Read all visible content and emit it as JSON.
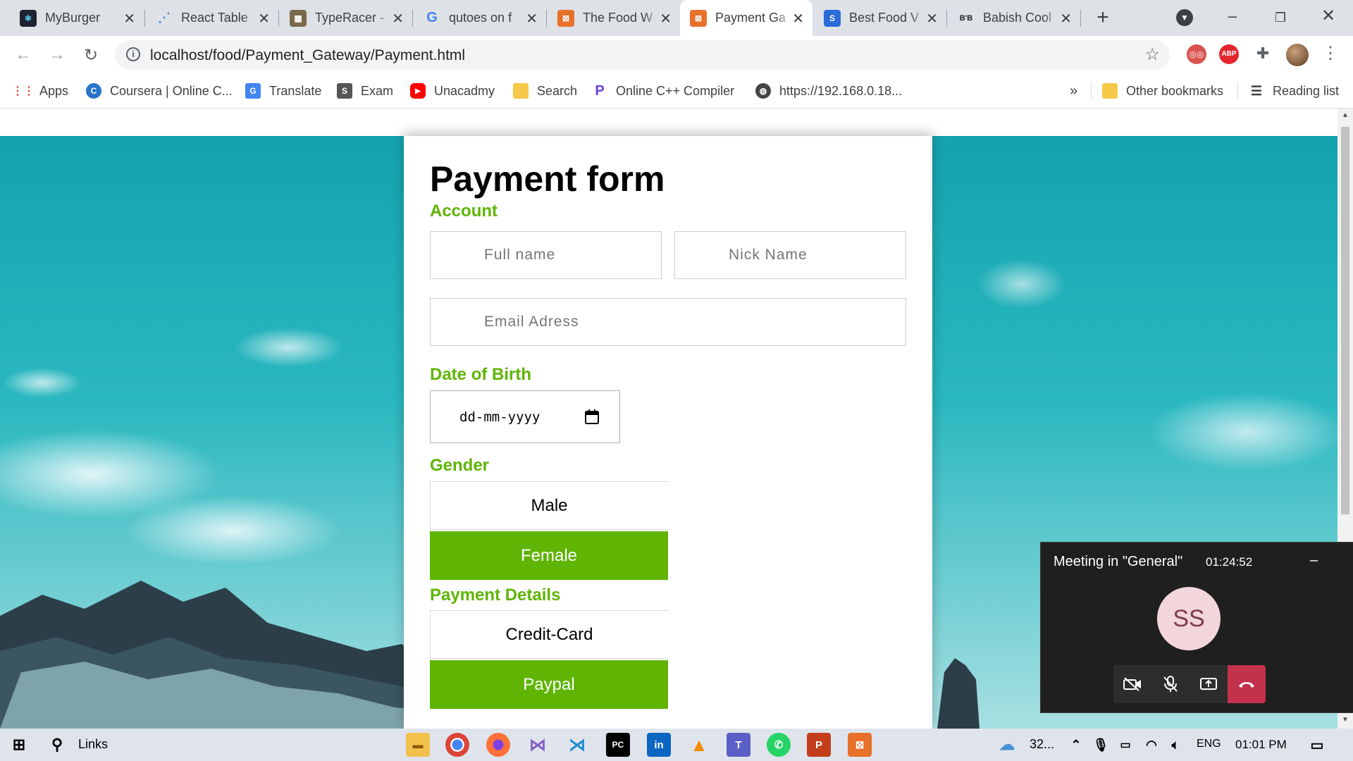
{
  "tabs": [
    {
      "title": "MyBurger",
      "favicon_text": "⚛",
      "color": "#1c2433"
    },
    {
      "title": "React Table",
      "favicon_text": "⋰",
      "color": "#4b8bde"
    },
    {
      "title": "TypeRacer -",
      "favicon_text": "▦",
      "color": "#7a6a4b"
    },
    {
      "title": "qutoes on f",
      "favicon_text": "G",
      "color": "#ffffff"
    },
    {
      "title": "The Food W",
      "favicon_text": "⊠",
      "color": "#e8702a"
    },
    {
      "title": "Payment Ga",
      "favicon_text": "⊠",
      "color": "#e8702a"
    },
    {
      "title": "Best Food V",
      "favicon_text": "S",
      "color": "#2a6bd8"
    },
    {
      "title": "Babish Cool",
      "favicon_text": "B'B",
      "color": "#222222"
    }
  ],
  "toolbar": {
    "url": "localhost/food/Payment_Gateway/Payment.html",
    "info_icon": "info-icon"
  },
  "bookmarks": [
    {
      "label": "Apps",
      "icon_text": "⋮⋮",
      "color": "#4285f4"
    },
    {
      "label": "Coursera | Online C...",
      "icon_text": "C",
      "color": "#2a73cc"
    },
    {
      "label": "Translate",
      "icon_text": "G",
      "color": "#4285f4"
    },
    {
      "label": "Exam",
      "icon_text": "S",
      "color": "#555555"
    },
    {
      "label": "Unacadmy",
      "icon_text": "▶",
      "color": "#ff0000"
    },
    {
      "label": "Search",
      "icon_text": "",
      "color": "#f7c948"
    },
    {
      "label": "Online C++ Compiler",
      "icon_text": "P",
      "color": "#6c3fe0"
    },
    {
      "label": "https://192.168.0.18...",
      "icon_text": "◍",
      "color": "#444444"
    }
  ],
  "bookmarks_right": {
    "overflow": "»",
    "other": "Other bookmarks",
    "reading": "Reading list"
  },
  "form": {
    "title": "Payment form",
    "account_label": "Account",
    "full_name_placeholder": "Full name",
    "nick_name_placeholder": "Nick Name",
    "email_placeholder": "Email Adress",
    "dob_label": "Date of Birth",
    "dob_value": "dd-mm-yyyy",
    "gender_label": "Gender",
    "gender_male": "Male",
    "gender_female": "Female",
    "payment_label": "Payment Details",
    "pay_credit": "Credit-Card",
    "pay_paypal": "Paypal",
    "accent_color": "#5fb404"
  },
  "meeting": {
    "title": "Meeting in \"General\"",
    "timer": "01:24:52",
    "minimize": "–",
    "avatar_initials": "SS"
  },
  "taskbar": {
    "search_label": "Links",
    "weather": "32...",
    "language": "ENG",
    "clock": "01:01 PM"
  }
}
